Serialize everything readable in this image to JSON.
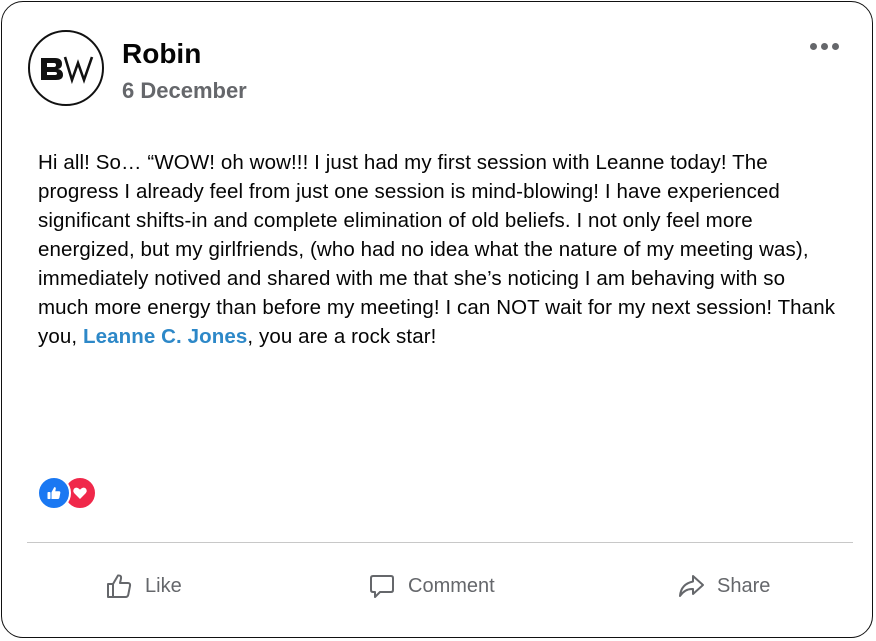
{
  "post": {
    "author": "Robin",
    "date": "6 December",
    "avatar_logo": "BW",
    "text_before_mention": "Hi all! So… “WOW! oh wow!!! I just had my first session with Leanne today! The progress I already feel from just one session is mind-blowing! I have experienced significant shifts-in and complete elimination of old beliefs. I not only feel more energized, but my girlfriends, (who had no idea what the nature of my meeting was), immediately notived and shared with me that she’s noticing I am behaving with so much more energy than before my meeting! I can NOT wait for my next session! Thank you, ",
    "mention": "Leanne C. Jones",
    "text_after_mention": ", you are a rock star!",
    "reactions": [
      "like-icon",
      "love-icon"
    ]
  },
  "actions": {
    "like": "Like",
    "comment": "Comment",
    "share": "Share"
  },
  "colors": {
    "mention": "#2d88c8",
    "like_reaction": "#1a78f2",
    "love_reaction": "#f0284a",
    "secondary_text": "#65676b"
  }
}
